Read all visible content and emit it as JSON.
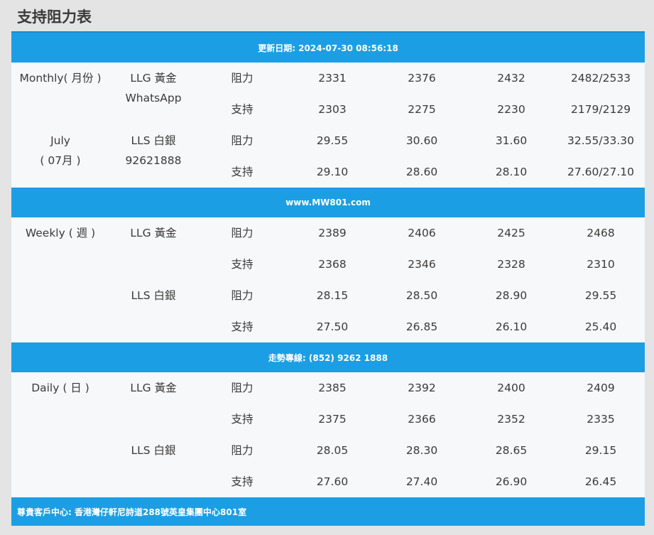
{
  "page_title": "支持阻力表",
  "banners": {
    "update": "更新日期: 2024-07-30 08:56:18",
    "website": "www.MW801.com",
    "hotline": "走勢專線: (852) 9262 1888",
    "footer": "尊貴客戶中心: 香港灣仔軒尼詩道288號英皇集團中心801室"
  },
  "labels": {
    "resistance": "阻力",
    "support": "支持"
  },
  "monthly": {
    "period": "Monthly( 月份 )",
    "month_en": "July",
    "month_zh": "( 07月 )",
    "llg_label": "LLG 黃金",
    "whatsapp_label": "WhatsApp",
    "lls_label": "LLS 白銀",
    "phone": "92621888",
    "llg_resistance": [
      "2331",
      "2376",
      "2432",
      "2482/2533"
    ],
    "llg_support": [
      "2303",
      "2275",
      "2230",
      "2179/2129"
    ],
    "lls_resistance": [
      "29.55",
      "30.60",
      "31.60",
      "32.55/33.30"
    ],
    "lls_support": [
      "29.10",
      "28.60",
      "28.10",
      "27.60/27.10"
    ]
  },
  "weekly": {
    "period": "Weekly ( 週 )",
    "llg_label": "LLG 黃金",
    "lls_label": "LLS 白銀",
    "llg_resistance": [
      "2389",
      "2406",
      "2425",
      "2468"
    ],
    "llg_support": [
      "2368",
      "2346",
      "2328",
      "2310"
    ],
    "lls_resistance": [
      "28.15",
      "28.50",
      "28.90",
      "29.55"
    ],
    "lls_support": [
      "27.50",
      "26.85",
      "26.10",
      "25.40"
    ]
  },
  "daily": {
    "period": "Daily ( 日 )",
    "llg_label": "LLG 黃金",
    "lls_label": "LLS 白銀",
    "llg_resistance": [
      "2385",
      "2392",
      "2400",
      "2409"
    ],
    "llg_support": [
      "2375",
      "2366",
      "2352",
      "2335"
    ],
    "lls_resistance": [
      "28.05",
      "28.30",
      "28.65",
      "29.15"
    ],
    "lls_support": [
      "27.60",
      "27.40",
      "26.90",
      "26.45"
    ]
  }
}
